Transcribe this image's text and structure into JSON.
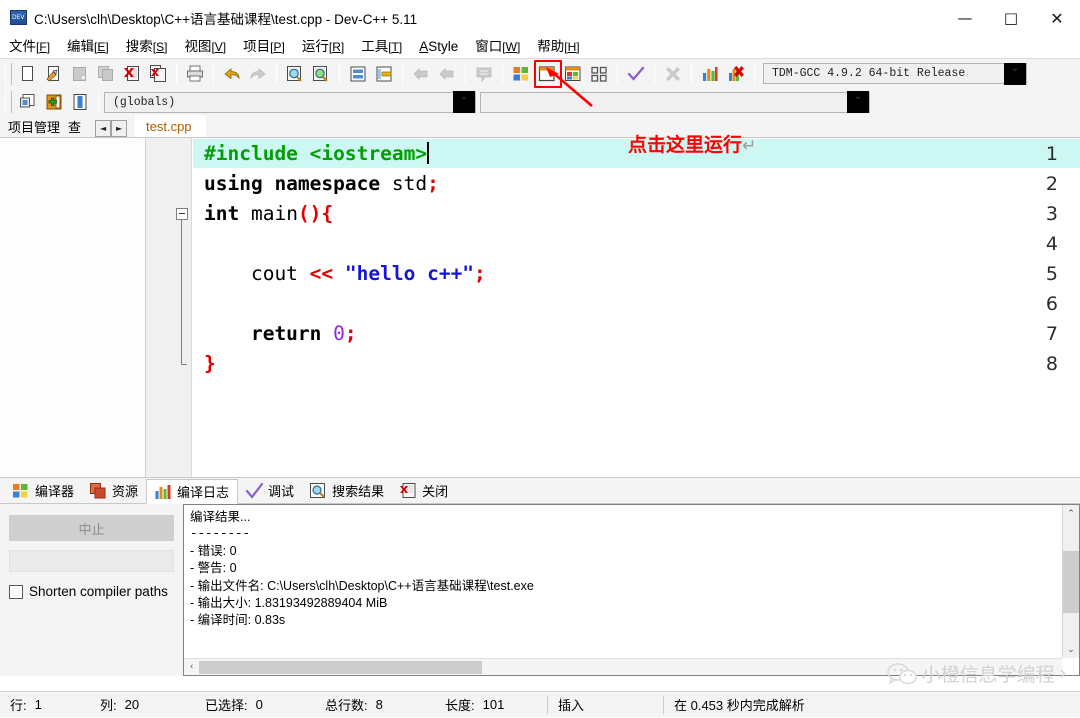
{
  "window": {
    "title": "C:\\Users\\clh\\Desktop\\C++语言基础课程\\test.cpp - Dev-C++ 5.11",
    "minimize": "—",
    "maximize": "□",
    "close": "✕"
  },
  "menubar": {
    "items": [
      {
        "label": "文件",
        "key": "F"
      },
      {
        "label": "编辑",
        "key": "E"
      },
      {
        "label": "搜索",
        "key": "S"
      },
      {
        "label": "视图",
        "key": "V"
      },
      {
        "label": "项目",
        "key": "P"
      },
      {
        "label": "运行",
        "key": "R"
      },
      {
        "label": "工具",
        "key": "T"
      },
      {
        "label": "AStyle",
        "key": ""
      },
      {
        "label": "窗口",
        "key": "W"
      },
      {
        "label": "帮助",
        "key": "H"
      }
    ]
  },
  "toolbar": {
    "compiler_select": "TDM-GCC 4.9.2 64-bit Release",
    "scope_select": "(globals)",
    "icons": [
      "new-file-icon",
      "open-file-icon",
      "save-icon",
      "save-all-icon",
      "close-file-icon",
      "close-all-icon",
      "print-icon",
      "undo-icon",
      "redo-icon",
      "find-icon",
      "replace-icon",
      "goto-line-icon",
      "goto-function-icon",
      "back-icon",
      "forward-icon",
      "comment-icon",
      "compile-icon",
      "run-icon",
      "compile-run-icon",
      "rebuild-icon",
      "syntax-check-icon",
      "stop-icon",
      "profile-icon",
      "delete-profile-icon"
    ],
    "project_icons": [
      "new-project-icon",
      "add-to-project-icon",
      "remove-from-project-icon"
    ]
  },
  "annotation": {
    "text": "点击这里运行",
    "return_symbol": "↵",
    "color": "#ff0000"
  },
  "panels": {
    "left_tabs": [
      {
        "label": "项目管理"
      },
      {
        "label": "查"
      },
      {
        "label": "◄"
      },
      {
        "label": "►"
      }
    ],
    "file_tab": "test.cpp"
  },
  "editor": {
    "cursor_line": 1,
    "lines": [
      {
        "n": "1",
        "tokens": [
          {
            "t": "#include <iostream>",
            "c": "green"
          }
        ],
        "highlight": true,
        "caret": true
      },
      {
        "n": "2",
        "tokens": [
          {
            "t": "using namespace ",
            "c": "bold"
          },
          {
            "t": "std",
            "c": "black"
          },
          {
            "t": ";",
            "c": "red"
          }
        ]
      },
      {
        "n": "3",
        "tokens": [
          {
            "t": "int ",
            "c": "bold"
          },
          {
            "t": "main",
            "c": "black"
          },
          {
            "t": "(){",
            "c": "red"
          }
        ],
        "fold": "start"
      },
      {
        "n": "4",
        "tokens": []
      },
      {
        "n": "5",
        "tokens": [
          {
            "t": "    cout ",
            "c": "black"
          },
          {
            "t": "<< ",
            "c": "red"
          },
          {
            "t": "\"hello c++\"",
            "c": "blue"
          },
          {
            "t": ";",
            "c": "red"
          }
        ]
      },
      {
        "n": "6",
        "tokens": []
      },
      {
        "n": "7",
        "tokens": [
          {
            "t": "    return ",
            "c": "bold"
          },
          {
            "t": "0",
            "c": "purple"
          },
          {
            "t": ";",
            "c": "red"
          }
        ]
      },
      {
        "n": "8",
        "tokens": [
          {
            "t": "}",
            "c": "red"
          }
        ],
        "fold": "end"
      }
    ]
  },
  "bottom_tabs": [
    {
      "label": "编译器",
      "icon": "compiler-icon",
      "active": false
    },
    {
      "label": "资源",
      "icon": "resources-icon",
      "active": false
    },
    {
      "label": "编译日志",
      "icon": "compile-log-icon",
      "active": true
    },
    {
      "label": "调试",
      "icon": "debug-icon",
      "active": false
    },
    {
      "label": "搜索结果",
      "icon": "search-results-icon",
      "active": false
    },
    {
      "label": "关闭",
      "icon": "close-panel-icon",
      "active": false
    }
  ],
  "compile_panel": {
    "abort_label": "中止",
    "progress_value": "",
    "shorten_label": "Shorten compiler paths",
    "log_lines": [
      "编译结果...",
      "--------",
      "- 错误: 0",
      "- 警告: 0",
      "- 输出文件名: C:\\Users\\clh\\Desktop\\C++语言基础课程\\test.exe",
      "- 输出大小: 1.83193492889404 MiB",
      "- 编译时间: 0.83s"
    ]
  },
  "statusbar": {
    "row_label": "行:",
    "row_value": "1",
    "col_label": "列:",
    "col_value": "20",
    "sel_label": "已选择:",
    "sel_value": "0",
    "total_label": "总行数:",
    "total_value": "8",
    "len_label": "长度:",
    "len_value": "101",
    "mode": "插入",
    "parse": "在 0.453 秒内完成解析"
  },
  "watermark": {
    "text": "小橙信息学编程",
    "chevron": "›"
  }
}
